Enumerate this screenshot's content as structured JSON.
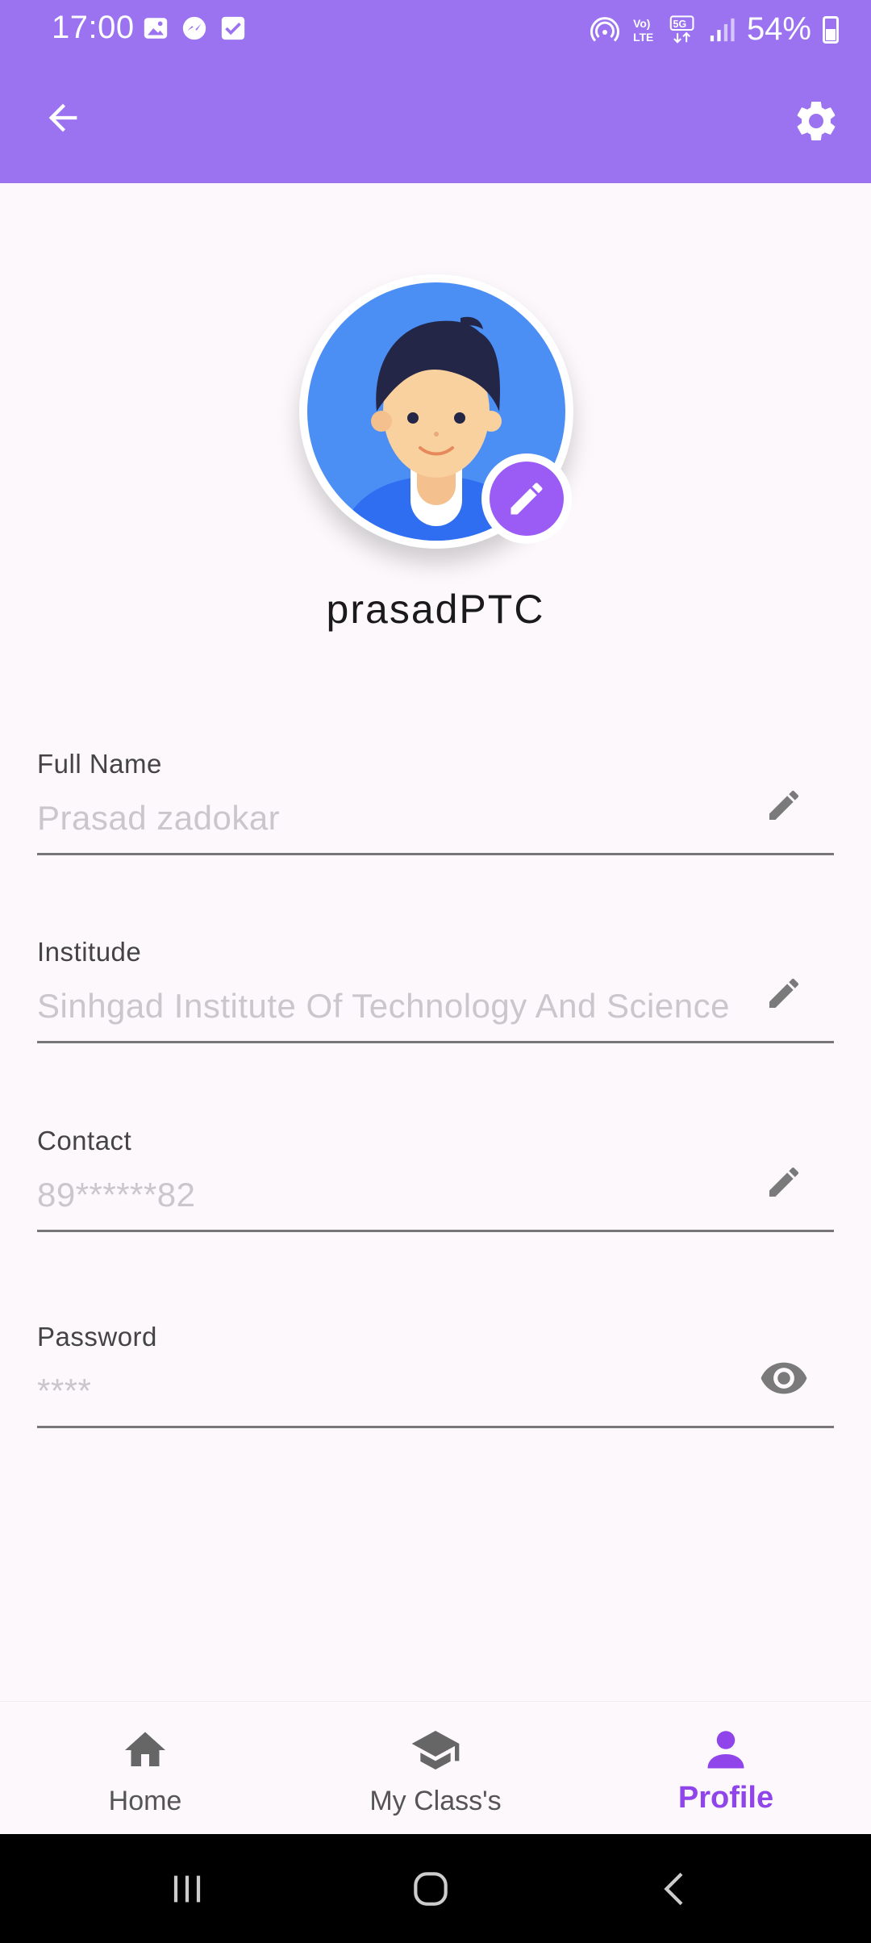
{
  "status_bar": {
    "time": "17:00",
    "battery": "54%",
    "icons": [
      "gallery-icon",
      "messenger-icon",
      "checkbox-icon",
      "hotspot-icon",
      "volte-icon",
      "5g-icon",
      "signal-icon",
      "battery-icon"
    ]
  },
  "app_bar": {
    "back_icon": "arrow-back-icon",
    "settings_icon": "gear-icon",
    "color": "#9b73f1"
  },
  "profile": {
    "username": "prasadPTC",
    "avatar_icon": "avatar-boy-icon",
    "edit_icon": "pencil-icon"
  },
  "fields": [
    {
      "label": "Full Name",
      "value": "Prasad zadokar",
      "action_icon": "pencil-icon"
    },
    {
      "label": "Institude",
      "value": "Sinhgad Institute Of Technology And Science",
      "action_icon": "pencil-icon"
    },
    {
      "label": "Contact",
      "value": "89******82",
      "action_icon": "pencil-icon"
    },
    {
      "label": "Password",
      "value": "****",
      "action_icon": "eye-icon"
    }
  ],
  "bottom_nav": {
    "items": [
      {
        "label": "Home",
        "icon": "home-icon"
      },
      {
        "label": "My Class's",
        "icon": "graduation-cap-icon"
      },
      {
        "label": "Profile",
        "icon": "person-icon",
        "active": true
      }
    ],
    "active_color": "#8f45ea"
  },
  "system_nav": [
    "recents-icon",
    "home-circle-icon",
    "back-chevron-icon"
  ]
}
